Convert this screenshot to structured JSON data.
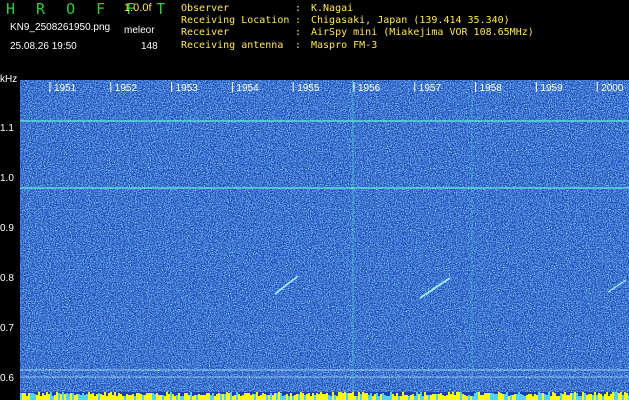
{
  "header": {
    "app_title": "H R O F F T",
    "version": "1.0.0f",
    "filename": "KN9_2508261950.png",
    "mode": "meleor",
    "datetime": "25.08.26 19:50",
    "count": "148"
  },
  "info": [
    {
      "key": "Observer",
      "value": "K.Nagai"
    },
    {
      "key": "Receiving Location",
      "value": "Chigasaki, Japan (139.414 35.340)"
    },
    {
      "key": "Receiver",
      "value": "AirSpy mini (Miakejima VOR 108.65MHz)"
    },
    {
      "key": "Receiving antenna",
      "value": "Maspro FM-3"
    }
  ],
  "separator": ":",
  "axis": {
    "unit": "kHz",
    "y_ticks": [
      "1.1",
      "1.0",
      "0.9",
      "0.8",
      "0.7",
      "0.6"
    ],
    "x_ticks": [
      "1951",
      "1952",
      "1953",
      "1954",
      "1955",
      "1956",
      "1957",
      "1958",
      "1959",
      "2000"
    ]
  },
  "colors": {
    "background": "#1a3fb0",
    "header_text": "#ffe84a",
    "title_green": "#2ecc40",
    "carrier_line": "#5ff0d8",
    "bottom_bar": "#ffff00"
  }
}
